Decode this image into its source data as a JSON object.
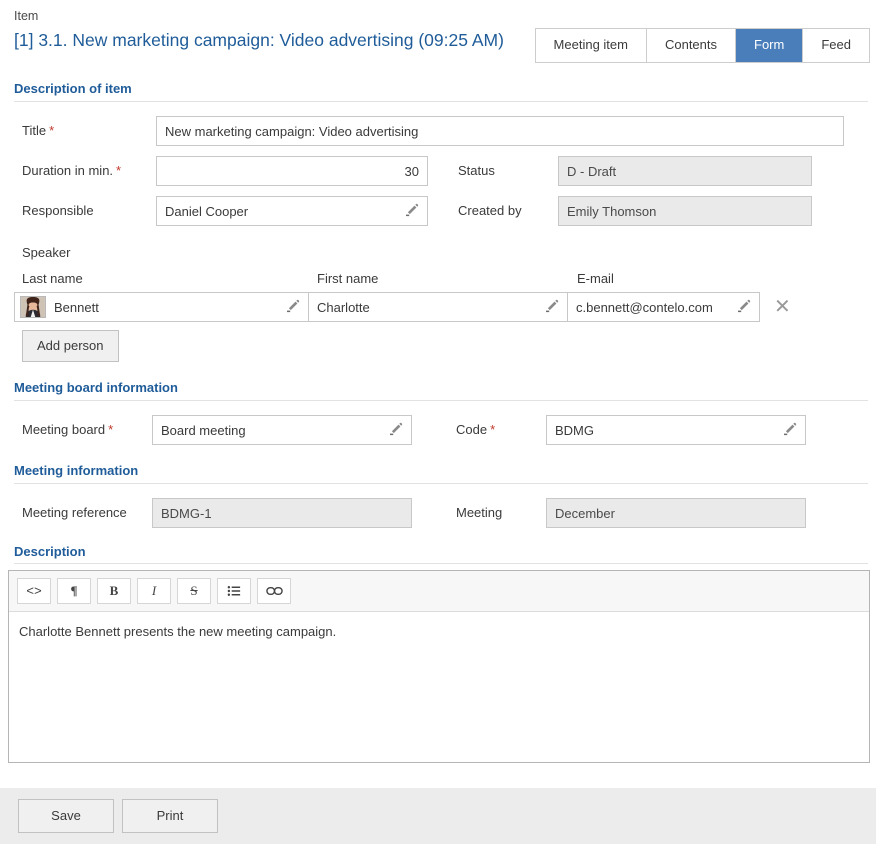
{
  "header": {
    "eyebrow": "Item",
    "title": "[1] 3.1. New marketing campaign: Video advertising (09:25 AM)"
  },
  "tabs": [
    {
      "label": "Meeting item",
      "active": false
    },
    {
      "label": "Contents",
      "active": false
    },
    {
      "label": "Form",
      "active": true
    },
    {
      "label": "Feed",
      "active": false
    }
  ],
  "colors": {
    "accent": "#1f5c99",
    "active_tab": "#4a7ebb",
    "required": "#c0392b",
    "readonly_bg": "#eaeaea"
  },
  "sections": {
    "description_of_item": {
      "heading": "Description of item",
      "title_label": "Title",
      "title_value": "New marketing campaign: Video advertising",
      "duration_label": "Duration in min.",
      "duration_value": "30",
      "responsible_label": "Responsible",
      "responsible_value": "Daniel Cooper",
      "status_label": "Status",
      "status_value": "D - Draft",
      "created_by_label": "Created by",
      "created_by_value": "Emily Thomson"
    },
    "speaker": {
      "heading": "Speaker",
      "columns": {
        "last_name": "Last name",
        "first_name": "First name",
        "email": "E-mail"
      },
      "rows": [
        {
          "last_name": "Bennett",
          "first_name": "Charlotte",
          "email": "c.bennett@contelo.com"
        }
      ],
      "add_person_label": "Add person",
      "remove_icon": "✕"
    },
    "meeting_board_information": {
      "heading": "Meeting board information",
      "meeting_board_label": "Meeting board",
      "meeting_board_value": "Board meeting",
      "code_label": "Code",
      "code_value": "BDMG"
    },
    "meeting_information": {
      "heading": "Meeting information",
      "meeting_reference_label": "Meeting reference",
      "meeting_reference_value": "BDMG-1",
      "meeting_label": "Meeting",
      "meeting_value": "December"
    },
    "description": {
      "heading": "Description",
      "toolbar": [
        {
          "name": "source-code-icon",
          "glyph": "<>"
        },
        {
          "name": "paragraph-icon",
          "glyph": "¶"
        },
        {
          "name": "bold-icon",
          "glyph": "B"
        },
        {
          "name": "italic-icon",
          "glyph": "I"
        },
        {
          "name": "strikethrough-icon",
          "glyph": "S"
        },
        {
          "name": "bullet-list-icon",
          "glyph": "☰"
        },
        {
          "name": "link-icon",
          "glyph": "∞"
        }
      ],
      "body_text": "Charlotte Bennett presents the new meeting campaign."
    }
  },
  "footer": {
    "save_label": "Save",
    "print_label": "Print"
  }
}
